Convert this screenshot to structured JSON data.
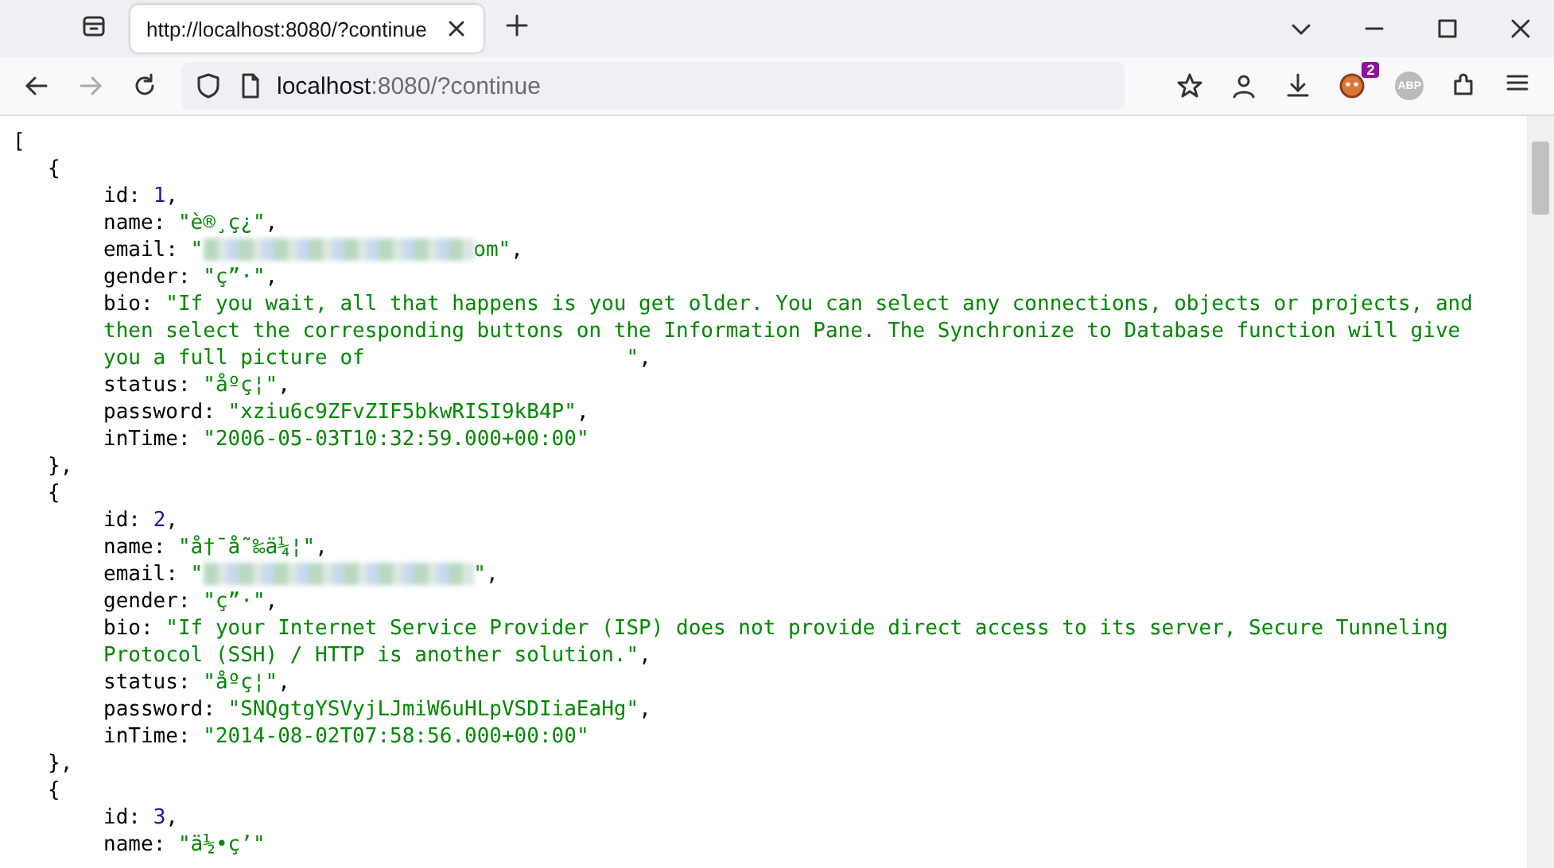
{
  "tab": {
    "title": "http://localhost:8080/?continue",
    "selected": true
  },
  "address": {
    "host": "localhost",
    "rest": ":8080/?continue"
  },
  "extension_badge": "2",
  "abp_label": "ABP",
  "json_view": {
    "open": "[",
    "colon": ":",
    "quote": "\"",
    "comma": ",",
    "records": [
      {
        "open": "{",
        "close": "},",
        "fields": [
          {
            "key": "id",
            "kind": "number",
            "value": "1"
          },
          {
            "key": "name",
            "kind": "string",
            "value": "è®¸ç¿"
          },
          {
            "key": "email",
            "kind": "blurred",
            "value": "om"
          },
          {
            "key": "gender",
            "kind": "string",
            "value": "ç”·"
          },
          {
            "key": "bio",
            "kind": "string",
            "value": "If you wait, all that happens is you get older. You can select any connections, objects or projects, and then select the corresponding buttons on the Information Pane. The Synchronize to Database function will give you a full picture of                     "
          },
          {
            "key": "status",
            "kind": "string",
            "value": "åºç¦"
          },
          {
            "key": "password",
            "kind": "string",
            "value": "xziu6c9ZFvZIF5bkwRISI9kB4P"
          },
          {
            "key": "inTime",
            "kind": "string",
            "value": "2006-05-03T10:32:59.000+00:00"
          }
        ]
      },
      {
        "open": "{",
        "close": "},",
        "fields": [
          {
            "key": "id",
            "kind": "number",
            "value": "2"
          },
          {
            "key": "name",
            "kind": "string",
            "value": "å†¯å˜‰ä¼¦"
          },
          {
            "key": "email",
            "kind": "blurred"
          },
          {
            "key": "gender",
            "kind": "string",
            "value": "ç”·"
          },
          {
            "key": "bio",
            "kind": "string",
            "value": "If your Internet Service Provider (ISP) does not provide direct access to its server, Secure Tunneling Protocol (SSH) / HTTP is another solution."
          },
          {
            "key": "status",
            "kind": "string",
            "value": "åºç¦"
          },
          {
            "key": "password",
            "kind": "string",
            "value": "SNQgtgYSVyjLJmiW6uHLpVSDIiaEaHg"
          },
          {
            "key": "inTime",
            "kind": "string",
            "value": "2014-08-02T07:58:56.000+00:00"
          }
        ]
      },
      {
        "open": "{",
        "fields": [
          {
            "key": "id",
            "kind": "number",
            "value": "3"
          },
          {
            "key": "name",
            "kind": "string",
            "value": "ä½•ç’"
          }
        ]
      }
    ]
  }
}
